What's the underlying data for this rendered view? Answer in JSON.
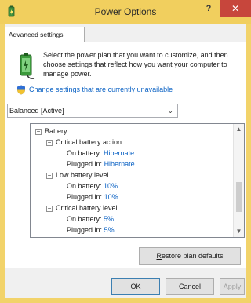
{
  "window": {
    "title": "Power Options",
    "help_label": "?",
    "close_label": "✕"
  },
  "tab": {
    "label": "Advanced settings"
  },
  "intro": {
    "text": "Select the power plan that you want to customize, and then choose settings that reflect how you want your computer to manage power."
  },
  "change_link": "Change settings that are currently unavailable",
  "plan_select": {
    "value": "Balanced [Active]",
    "chevron": "⌄"
  },
  "tree": {
    "items": [
      {
        "expander": "−",
        "label": "Battery"
      },
      {
        "expander": "−",
        "label": "Critical battery action"
      },
      {
        "label": "On battery:",
        "value": "Hibernate"
      },
      {
        "label": "Plugged in:",
        "value": "Hibernate"
      },
      {
        "expander": "−",
        "label": "Low battery level"
      },
      {
        "label": "On battery:",
        "value": "10%"
      },
      {
        "label": "Plugged in:",
        "value": "10%"
      },
      {
        "expander": "−",
        "label": "Critical battery level"
      },
      {
        "label": "On battery:",
        "value": "5%"
      },
      {
        "label": "Plugged in:",
        "value": "5%"
      }
    ],
    "scroll_up": "▲",
    "scroll_down": "▼"
  },
  "buttons": {
    "restore": {
      "accel": "R",
      "rest": "estore plan defaults"
    },
    "ok": "OK",
    "cancel": "Cancel",
    "apply": "Apply"
  },
  "colors": {
    "title_bar": "#f1cf5e",
    "close_button": "#c7463c",
    "link": "#0b62c4"
  },
  "icons": {
    "title": "power-plan-icon",
    "plan": "battery-plug-icon",
    "shield": "uac-shield-icon"
  }
}
